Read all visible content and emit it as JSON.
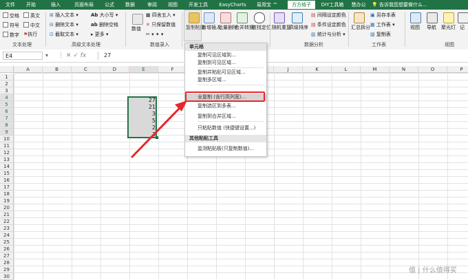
{
  "tabs": [
    {
      "label": "文件",
      "active": false
    },
    {
      "label": "开始",
      "active": false
    },
    {
      "label": "插入",
      "active": false
    },
    {
      "label": "页面布局",
      "active": false
    },
    {
      "label": "公式",
      "active": false
    },
    {
      "label": "数据",
      "active": false
    },
    {
      "label": "审阅",
      "active": false
    },
    {
      "label": "视图",
      "active": false
    },
    {
      "label": "开发工具",
      "active": false
    },
    {
      "label": "EasyCharts",
      "active": false
    },
    {
      "label": "易用宝 ™",
      "active": false
    },
    {
      "label": "方方格子",
      "active": true
    },
    {
      "label": "DIY工具箱",
      "active": false
    },
    {
      "label": "慧办公",
      "active": false
    }
  ],
  "tell_me": "告诉我您想要做什么...",
  "ribbon": {
    "text_processing": {
      "checks": [
        "空格",
        "英文",
        "符号",
        "中文",
        "数字",
        "执行"
      ],
      "group": "文本处理"
    },
    "advanced_text": {
      "items": [
        "插入文本",
        "删除文本",
        "截取文本",
        "大小写",
        "删除空格",
        "更多"
      ],
      "group": "高级文本处理"
    },
    "numeric": {
      "items": [
        "数值",
        "四舍五入",
        "只保留数值"
      ],
      "group": "数值录入"
    },
    "editing": {
      "items": [
        "复制粘贴",
        "新增插入",
        "批量删除",
        "合并转换",
        "查找定位"
      ]
    },
    "analysis": {
      "items": [
        "随机重复",
        "高级排序",
        "间隔设定颜色",
        "条件设定颜色",
        "统计与分析"
      ],
      "group": "数据分析"
    },
    "worksheet": {
      "items": [
        "汇总拆分",
        "另存本表",
        "工作表",
        "复制表"
      ],
      "group": "工作表"
    },
    "view": {
      "items": [
        "视图",
        "导航",
        "聚光灯",
        "记"
      ],
      "group": "视图"
    }
  },
  "name_box": "E4",
  "formula": "27",
  "columns": [
    "A",
    "B",
    "C",
    "D",
    "E",
    "F",
    "G",
    "H",
    "I",
    "J",
    "K",
    "L",
    "M",
    "N",
    "O",
    "P"
  ],
  "rows": [
    "1",
    "2",
    "3",
    "4",
    "5",
    "6",
    "7",
    "8",
    "9",
    "10",
    "11",
    "12",
    "13",
    "14",
    "15",
    "16",
    "17",
    "18",
    "19",
    "20",
    "21",
    "22",
    "23",
    "24",
    "25",
    "26",
    "27",
    "28",
    "29",
    "30"
  ],
  "cell_values": [
    "27",
    "21",
    "3",
    "5",
    "2",
    "3"
  ],
  "dropdown": {
    "section1": "单元格",
    "items": [
      "复制可见区域到...",
      "复制到可见区域...",
      "复制并粘贴可见区域...",
      "复制多区域...",
      "全复制 (含行高列宽)...",
      "复制选区到多表...",
      "复制到合并区域...",
      "只粘贴数值 (快捷键设置...)"
    ],
    "selected_index": 4,
    "section2": "其他粘贴工具",
    "items2": [
      "监测粘贴板(只复制数值)..."
    ]
  },
  "watermark": "值 | 什么值得买",
  "colors": {
    "accent": "#217346",
    "annotation": "#e8262a"
  }
}
